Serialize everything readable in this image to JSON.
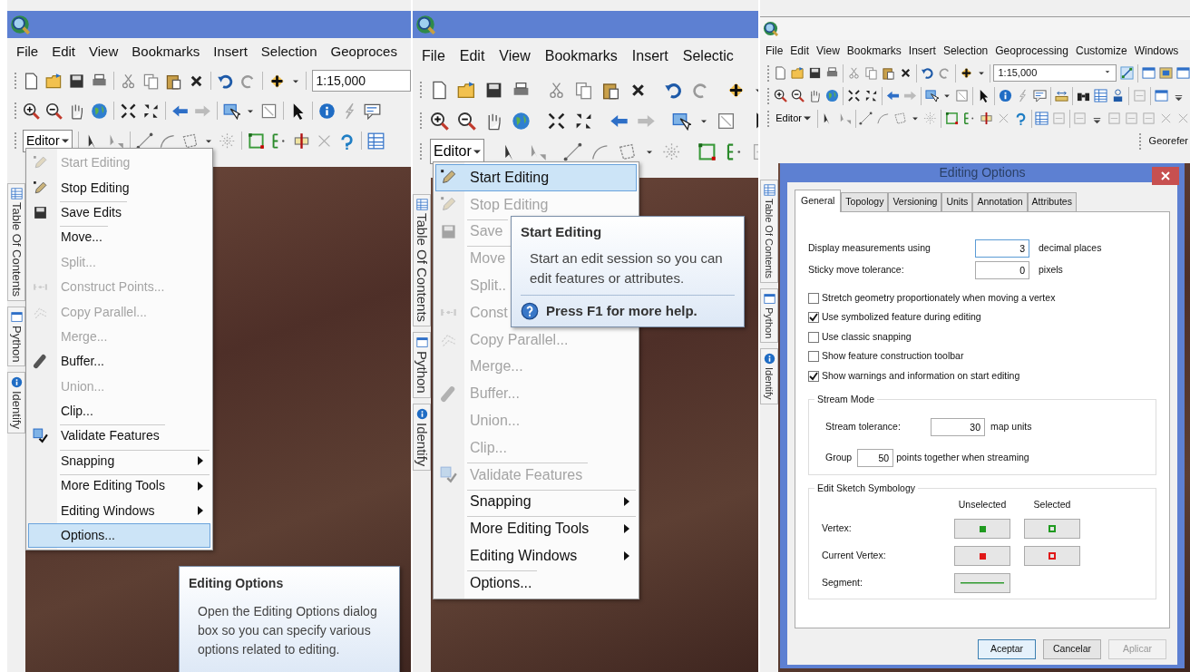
{
  "panels": [
    {
      "active": true,
      "menubar": [
        "File",
        "Edit",
        "View",
        "Bookmarks",
        "Insert",
        "Selection",
        "Geoproces"
      ],
      "scale": "1:15,000",
      "editor": "Editor",
      "side_tabs": [
        "Table Of Contents",
        "Python",
        "Identify"
      ],
      "editor_menu": [
        {
          "label": "Start Editing",
          "kind": "item",
          "disabled": true,
          "selected": false,
          "divider": false
        },
        {
          "label": "Stop Editing",
          "kind": "item",
          "disabled": false,
          "selected": false,
          "divider": false
        },
        {
          "label": "Save Edits",
          "kind": "item",
          "disabled": false,
          "selected": false,
          "divider": true
        },
        {
          "label": "Move...",
          "kind": "item",
          "disabled": false,
          "selected": false,
          "divider": true
        },
        {
          "label": "Split...",
          "kind": "item",
          "disabled": true,
          "selected": false,
          "divider": false
        },
        {
          "label": "Construct Points...",
          "kind": "item",
          "disabled": true,
          "selected": false,
          "divider": false
        },
        {
          "label": "Copy Parallel...",
          "kind": "item",
          "disabled": true,
          "selected": false,
          "divider": false
        },
        {
          "label": "Merge...",
          "kind": "item",
          "disabled": true,
          "selected": false,
          "divider": false
        },
        {
          "label": "Buffer...",
          "kind": "item",
          "disabled": false,
          "selected": false,
          "divider": false
        },
        {
          "label": "Union...",
          "kind": "item",
          "disabled": true,
          "selected": false,
          "divider": false
        },
        {
          "label": "Clip...",
          "kind": "item",
          "disabled": false,
          "selected": false,
          "divider": false
        },
        {
          "label": "Validate Features",
          "kind": "item",
          "disabled": false,
          "selected": false,
          "divider": true
        },
        {
          "label": "Snapping",
          "kind": "submenu",
          "disabled": false,
          "selected": false,
          "divider": true
        },
        {
          "label": "More Editing Tools",
          "kind": "submenu",
          "disabled": false,
          "selected": false,
          "divider": true
        },
        {
          "label": "Editing Windows",
          "kind": "submenu",
          "disabled": false,
          "selected": false,
          "divider": false
        },
        {
          "label": "Options...",
          "kind": "item",
          "disabled": false,
          "selected": true,
          "divider": true
        }
      ],
      "tooltip": {
        "title": "Editing Options",
        "body": "Open the Editing Options dialog box so you can specify various options related to editing."
      }
    },
    {
      "active": true,
      "menubar": [
        "File",
        "Edit",
        "View",
        "Bookmarks",
        "Insert",
        "Selectic"
      ],
      "editor": "Editor",
      "side_tabs": [
        "Table Of Contents",
        "Python",
        "Identify"
      ],
      "editor_menu": [
        {
          "label": "Start Editing",
          "kind": "item",
          "disabled": false,
          "selected": true,
          "divider": false
        },
        {
          "label": "Stop Editing",
          "kind": "item",
          "disabled": true,
          "selected": false,
          "divider": false
        },
        {
          "label": "Save",
          "kind": "item",
          "disabled": true,
          "selected": false,
          "divider": true
        },
        {
          "label": "Move",
          "kind": "item",
          "disabled": true,
          "selected": false,
          "divider": true
        },
        {
          "label": "Split..",
          "kind": "item",
          "disabled": true,
          "selected": false,
          "divider": false
        },
        {
          "label": "Const",
          "kind": "item",
          "disabled": true,
          "selected": false,
          "divider": false
        },
        {
          "label": "Copy Parallel...",
          "kind": "item",
          "disabled": true,
          "selected": false,
          "divider": false
        },
        {
          "label": "Merge...",
          "kind": "item",
          "disabled": true,
          "selected": false,
          "divider": false
        },
        {
          "label": "Buffer...",
          "kind": "item",
          "disabled": true,
          "selected": false,
          "divider": false
        },
        {
          "label": "Union...",
          "kind": "item",
          "disabled": true,
          "selected": false,
          "divider": false
        },
        {
          "label": "Clip...",
          "kind": "item",
          "disabled": true,
          "selected": false,
          "divider": false
        },
        {
          "label": "Validate Features",
          "kind": "item",
          "disabled": true,
          "selected": false,
          "divider": true
        },
        {
          "label": "Snapping",
          "kind": "submenu",
          "disabled": false,
          "selected": false,
          "divider": true
        },
        {
          "label": "More Editing Tools",
          "kind": "submenu",
          "disabled": false,
          "selected": false,
          "divider": true
        },
        {
          "label": "Editing Windows",
          "kind": "submenu",
          "disabled": false,
          "selected": false,
          "divider": false
        },
        {
          "label": "Options...",
          "kind": "item",
          "disabled": false,
          "selected": false,
          "divider": true
        }
      ],
      "tooltip": {
        "title": "Start Editing",
        "body": "Start an edit session so you can edit features or attributes.",
        "help": "Press F1 for more help."
      }
    },
    {
      "active": false,
      "menubar": [
        "File",
        "Edit",
        "View",
        "Bookmarks",
        "Insert",
        "Selection",
        "Geoprocessing",
        "Customize",
        "Windows"
      ],
      "scale": "1:15,000",
      "editor": "Editor",
      "toolbar_label": "Georefer",
      "side_tabs": [
        "Table Of Contents",
        "Python",
        "Identify"
      ],
      "dialog": {
        "title": "Editing Options",
        "tabs": [
          {
            "label": "General",
            "selected": true
          },
          {
            "label": "Topology",
            "selected": false
          },
          {
            "label": "Versioning",
            "selected": false
          },
          {
            "label": "Units",
            "selected": false
          },
          {
            "label": "Annotation",
            "selected": false
          },
          {
            "label": "Attributes",
            "selected": false
          }
        ],
        "fields": [
          {
            "label": "Display measurements using",
            "value": "3",
            "unit": "decimal places"
          },
          {
            "label": "Sticky move tolerance:",
            "value": "0",
            "unit": "pixels"
          }
        ],
        "checkboxes": [
          {
            "label": "Stretch geometry proportionately when moving a vertex",
            "checked": false
          },
          {
            "label": "Use symbolized feature during editing",
            "checked": true
          },
          {
            "label": "Use classic snapping",
            "checked": false
          },
          {
            "label": "Show feature construction toolbar",
            "checked": false
          },
          {
            "label": "Show warnings and information on start editing",
            "checked": true
          }
        ],
        "stream_mode": {
          "title": "Stream Mode",
          "tolerance_label": "Stream tolerance:",
          "tolerance": "30",
          "tolerance_unit": "map units",
          "group_label": "Group",
          "group": "50",
          "group_unit": "points together when streaming"
        },
        "symbology": {
          "title": "Edit Sketch Symbology",
          "headers": [
            "Unselected",
            "Selected"
          ],
          "rows": [
            {
              "label": "Vertex:",
              "swatches": [
                {
                  "kind": "filled",
                  "color": "#1f9a1f"
                },
                {
                  "kind": "hollow",
                  "color": "#1f9a1f"
                }
              ]
            },
            {
              "label": "Current Vertex:",
              "swatches": [
                {
                  "kind": "filled",
                  "color": "#e01818"
                },
                {
                  "kind": "hollow",
                  "color": "#e01818"
                }
              ]
            },
            {
              "label": "Segment:",
              "swatches": [
                {
                  "kind": "line",
                  "color": "#2f9a2f"
                }
              ]
            }
          ]
        },
        "buttons": [
          {
            "label": "Aceptar",
            "disabled": false,
            "default": true
          },
          {
            "label": "Cancelar",
            "disabled": false,
            "default": false
          },
          {
            "label": "Aplicar",
            "disabled": true,
            "default": false
          }
        ]
      }
    }
  ]
}
